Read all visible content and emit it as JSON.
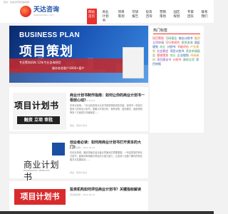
{
  "top_note": "您好，欢迎访问项目策划网",
  "brand": {
    "name": "天达咨询",
    "sub": "www.tiandacn.com"
  },
  "nav": [
    "网站首页",
    "商业计划书",
    "项目策划",
    "可研报告",
    "投资咨询",
    "营销策划",
    "园区规划",
    "专家团队",
    "联系我们"
  ],
  "hero": {
    "en": "BUSINESS PLAN",
    "cn": "项目策划",
    "line1": "专业策划机构 12年专业咨询经验",
    "line2": "服务各类客户3000+客户"
  },
  "articles": [
    {
      "thumb_big": "项目计划书",
      "thumb_bar": "融资 立项 审批",
      "title": "商业计划书制作指南：如何让你的商业计划书一看就心动？",
      "meta": "项目策划网 · 2024-09-05",
      "body": "在商业领域，一份出色的商业计划书是获得投资的关键。如何写一份吸引投资人的商业计划书，需要从市场分析、竞争优势、盈利模式、融资规划等多个方面进行详细阐述……",
      "foot": "阅读 · 项目计划书"
    },
    {
      "thumb_big": "商业计划书",
      "thumb_sub": "POWERPOINT TEMPLATE",
      "title": "创业者必读：如何用商业计划书打开资本的大门？",
      "meta": "项目策划网 · 2024-09-05",
      "body": "在创业领域，融资是每位创业者必须面对的重要课题。一份高质量的商业计划书，能够清晰地展示项目的价值与潜力，让投资人迅速了解你的商业模式与发展前景……",
      "foot": "阅读 · 项目计划书"
    },
    {
      "thumb_tag": "项目计划书",
      "title": "投资机构如何评估商业计划书？关键指标解读",
      "meta": "项目策划网 · 2024-09-05",
      "body": "",
      "foot": ""
    }
  ],
  "sidebar": {
    "title": "热门标签",
    "tags": [
      {
        "text": "项目策划",
        "color": "#e8322f"
      },
      {
        "text": "可研报告",
        "color": "#2e8b57"
      },
      {
        "text": "商业计划书",
        "color": "#1a4fa3"
      },
      {
        "text": "融资",
        "color": "#d08a00"
      },
      {
        "text": "立项申请",
        "color": "#7a3db8"
      },
      {
        "text": "可行性研究",
        "color": "#e8322f"
      },
      {
        "text": "投资咨询",
        "color": "#2e8b57"
      },
      {
        "text": "园区规划",
        "color": "#1a4fa3"
      },
      {
        "text": "商业",
        "color": "#4caf50"
      },
      {
        "text": "计划书",
        "color": "#1a4fa3"
      },
      {
        "text": "节能评估",
        "color": "#e8322f"
      },
      {
        "text": "产业规划",
        "color": "#d08a00"
      },
      {
        "text": "社会稳定",
        "color": "#7a3db8"
      },
      {
        "text": "项目计划书",
        "color": "#1a4fa3"
      },
      {
        "text": "资金申请报告",
        "color": "#2e8b57"
      },
      {
        "text": "营销策划",
        "color": "#e8322f"
      },
      {
        "text": "商业",
        "color": "#4caf50"
      },
      {
        "text": "企业规划",
        "color": "#1a4fa3"
      },
      {
        "text": "市场调研",
        "color": "#d08a00"
      },
      {
        "text": "项目建议书",
        "color": "#7a3db8"
      },
      {
        "text": "计划书",
        "color": "#e8322f"
      },
      {
        "text": "政府立项",
        "color": "#2e8b57"
      },
      {
        "text": "项目申报",
        "color": "#1a4fa3"
      }
    ]
  }
}
